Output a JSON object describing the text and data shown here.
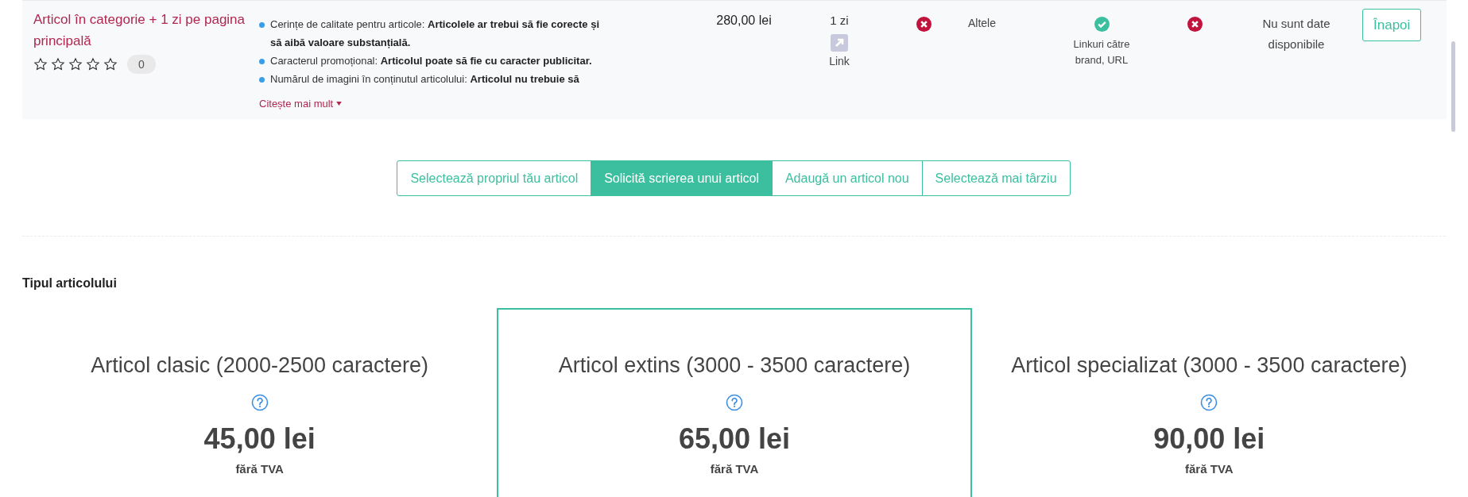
{
  "offer": {
    "title": "Articol în categorie + 1 zi pe pagina principală",
    "stars": 0,
    "review_count": "0",
    "requirements": [
      "Cerințe de calitate pentru articole: **Articolele ar trebui să fie corecte și să aibă valoare substanțială.**",
      "Caracterul promoțional: **Articolul poate să fie cu caracter publicitar.**",
      "Numărul de imagini în conținutul articolului: **Articolul nu trebuie să**"
    ],
    "read_more": "Citește mai mult",
    "price": "280,00 lei",
    "duration": "1 zi",
    "link_label": "Link",
    "cells": [
      {
        "kind": "status",
        "on": false
      },
      {
        "kind": "text",
        "text": "Altele"
      },
      {
        "kind": "status",
        "on": true,
        "text": "Linkuri către brand, URL"
      },
      {
        "kind": "status",
        "on": false
      },
      {
        "kind": "text",
        "text": "Nu sunt date disponibile"
      }
    ],
    "back_button": "Înapoi"
  },
  "tabs": [
    {
      "label": "Selectează propriul tău articol",
      "selected": false
    },
    {
      "label": "Solicită scrierea unui articol",
      "selected": true
    },
    {
      "label": "Adaugă un articol nou",
      "selected": false
    },
    {
      "label": "Selectează mai târziu",
      "selected": false
    }
  ],
  "section_title": "Tipul articolului",
  "article_types": [
    {
      "title": "Articol clasic (2000-2500 caractere)",
      "price": "45,00 lei",
      "note": "fără TVA",
      "selected": false
    },
    {
      "title": "Articol extins (3000 - 3500 caractere)",
      "price": "65,00 lei",
      "note": "fără TVA",
      "selected": true
    },
    {
      "title": "Articol specializat (3000 - 3500 caractere)",
      "price": "90,00 lei",
      "note": "fără TVA",
      "selected": false
    }
  ]
}
